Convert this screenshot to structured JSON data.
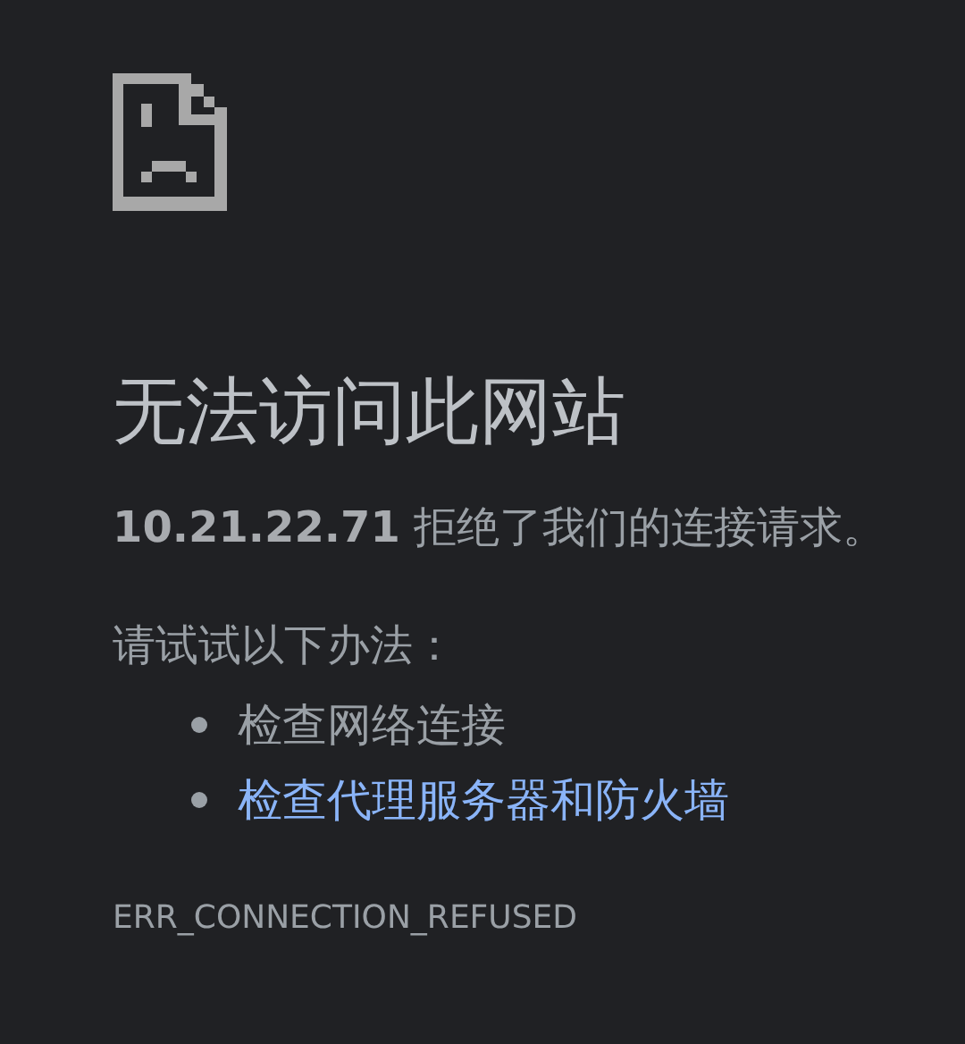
{
  "heading": "无法访问此网站",
  "message": "**10.21.22.71** 拒绝了我们的连接请求。",
  "suggestions_heading": "请试试以下办法：",
  "suggestions": [
    {
      "kind": "text",
      "label": "检查网络连接"
    },
    {
      "kind": "link",
      "label": "检查代理服务器和防火墙"
    }
  ],
  "error_code": "ERR_CONNECTION_REFUSED"
}
